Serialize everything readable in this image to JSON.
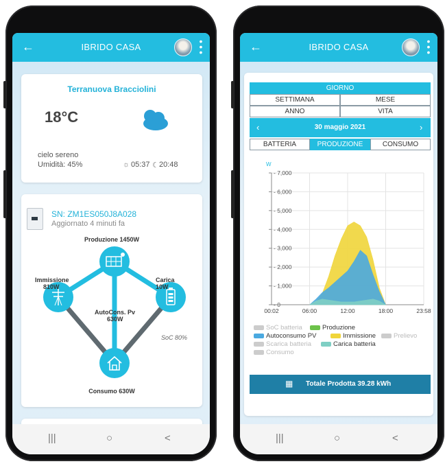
{
  "left": {
    "title": "IBRIDO CASA",
    "weather": {
      "city": "Terranuova Bracciolini",
      "temp": "18°C",
      "sky": "cielo sereno",
      "humidity": "Umidità: 45%",
      "sunrise": "05:37",
      "sunset": "20:48"
    },
    "device": {
      "sn": "SN: ZM1ES050J8A028",
      "updated": "Aggiornato 4 minuti fa"
    },
    "flow": {
      "production": "Produzione  1450W",
      "immission_label": "Immissione",
      "immission_value": "810W",
      "charge_label": "Carica",
      "charge_value": "10W",
      "autocons_label": "AutoCons. Pv",
      "autocons_value": "630W",
      "soc": "SoC 80%",
      "consumption": "Consumo  630W"
    }
  },
  "right": {
    "title": "IBRIDO CASA",
    "period": {
      "giorno": "GIORNO",
      "settimana": "SETTIMANA",
      "mese": "MESE",
      "anno": "ANNO",
      "vita": "VITA",
      "date": "30 maggio 2021",
      "prev": "‹",
      "next": "›"
    },
    "tabs": {
      "batteria": "BATTERIA",
      "produzione": "PRODUZIONE",
      "consumo": "CONSUMO"
    },
    "total": "Totale Prodotta 39.28 kWh"
  },
  "nav": {
    "recents": "|||",
    "home": "○",
    "back": "<"
  },
  "colors": {
    "accent": "#23bde0",
    "produzione": "#6cc24a",
    "autoconsumo": "#4aa9e0",
    "immissione": "#f0d53a",
    "carica_batteria": "#7fcfc4",
    "inactive": "#cccccc"
  },
  "chart_data": {
    "type": "area",
    "ylabel": "W",
    "ylim": [
      0,
      7000
    ],
    "yticks": [
      "0",
      "1,000",
      "2,000",
      "3,000",
      "4,000",
      "5,000",
      "6,000",
      "7,000"
    ],
    "xticks": [
      "00:02",
      "06:00",
      "12:00",
      "18:00",
      "23:58"
    ],
    "x": [
      "06:00",
      "07:00",
      "08:00",
      "09:00",
      "10:00",
      "11:00",
      "12:00",
      "13:00",
      "14:00",
      "15:00",
      "16:00",
      "17:00",
      "18:00"
    ],
    "series": [
      {
        "name": "Immissione",
        "values": [
          0,
          150,
          600,
          1500,
          2600,
          3500,
          4200,
          4400,
          4200,
          3600,
          2400,
          900,
          0
        ]
      },
      {
        "name": "Autoconsumo PV",
        "values": [
          0,
          300,
          650,
          900,
          1200,
          1500,
          1800,
          2300,
          2900,
          2600,
          1600,
          700,
          0
        ]
      },
      {
        "name": "Carica batteria",
        "values": [
          0,
          200,
          300,
          250,
          200,
          150,
          150,
          150,
          200,
          250,
          300,
          200,
          0
        ]
      }
    ],
    "legend": [
      {
        "label": "SoC batteria",
        "active": false
      },
      {
        "label": "Produzione",
        "active": true
      },
      {
        "label": "Prelievo",
        "active": false
      },
      {
        "label": "Autoconsumo PV",
        "active": true
      },
      {
        "label": "Immissione",
        "active": true
      },
      {
        "label": "Scarica batteria",
        "active": false
      },
      {
        "label": "Carica batteria",
        "active": true
      },
      {
        "label": "Consumo",
        "active": false
      }
    ]
  }
}
